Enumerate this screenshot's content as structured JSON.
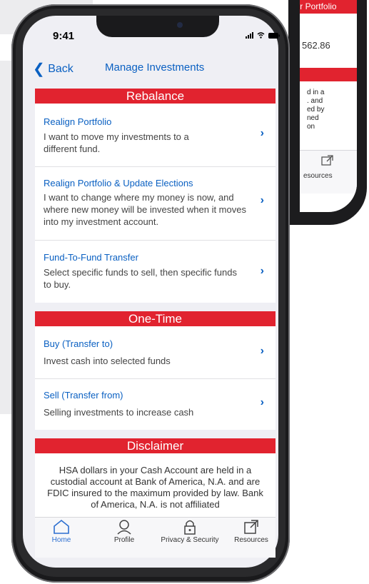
{
  "back_phone": {
    "header_label": "Your Portfolio",
    "amount": "562.86",
    "partial_text_lines": [
      "d in a",
      ". and",
      "ed by",
      "ned",
      "on"
    ],
    "tab_label": "esources"
  },
  "status_bar": {
    "time": "9:41"
  },
  "nav": {
    "back_label": "Back",
    "title": "Manage Investments"
  },
  "sections": {
    "rebalance": {
      "title": "Rebalance",
      "items": [
        {
          "title": "Realign Portfolio",
          "description": "I want to move my investments to a different fund."
        },
        {
          "title": "Realign Portfolio & Update Elections",
          "description": "I want to change where my money is now, and where new money will be invested when it moves into my investment account."
        },
        {
          "title": "Fund-To-Fund Transfer",
          "description": "Select specific funds to sell, then specific funds to buy."
        }
      ]
    },
    "one_time": {
      "title": "One-Time",
      "items": [
        {
          "title": "Buy (Transfer to)",
          "description": "Invest cash into selected funds"
        },
        {
          "title": "Sell (Transfer from)",
          "description": "Selling investments to increase cash"
        }
      ]
    },
    "disclaimer": {
      "title": "Disclaimer",
      "text": "HSA dollars in your Cash Account are held in a custodial account at Bank of America, N.A. and are FDIC insured to the maximum provided by law. Bank of America, N.A. is not affiliated"
    }
  },
  "tabbar": {
    "items": [
      {
        "label": "Home",
        "icon": "home-icon"
      },
      {
        "label": "Profile",
        "icon": "profile-icon"
      },
      {
        "label": "Privacy & Security",
        "icon": "lock-icon"
      },
      {
        "label": "Resources",
        "icon": "external-link-icon"
      }
    ]
  },
  "colors": {
    "accent_red": "#e1232f",
    "link_blue": "#0a60c2",
    "home_active": "#2d6fd0"
  }
}
